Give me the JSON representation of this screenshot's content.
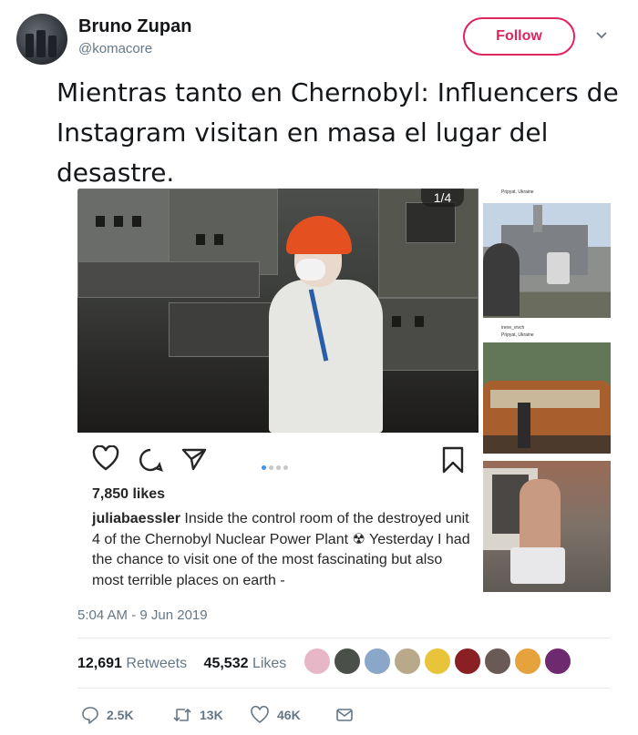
{
  "author": {
    "name": "Bruno Zupan",
    "handle": "@komacore",
    "follow_label": "Follow"
  },
  "tweet": {
    "text": "Mientras tanto en Chernobyl: Influencers de Instagram visitan en masa el lugar del desastre."
  },
  "instagram_post": {
    "page_indicator": "1/4",
    "carousel_position": 1,
    "carousel_total": 4,
    "likes": "7,850 likes",
    "username": "juliabaessler",
    "caption": "Inside the control room of the destroyed unit 4 of the Chernobyl Nuclear Power Plant ☢ Yesterday I had the chance to visit one of the most fascinating but also most terrible places on earth -"
  },
  "thumbnails": [
    {
      "location": "Pripyat, Ukraine"
    },
    {
      "user": "irene_vivch",
      "location": "Pripyat, Ukraine"
    },
    {}
  ],
  "meta": {
    "timestamp": "5:04 AM - 9 Jun 2019",
    "retweets_count": "12,691",
    "retweets_label": "Retweets",
    "likes_count": "45,532",
    "likes_label": "Likes"
  },
  "action_bar": {
    "replies": "2.5K",
    "retweets": "13K",
    "likes": "46K"
  },
  "colors": {
    "follow_accent": "#e0245e",
    "secondary_text": "#657786",
    "carousel_active": "#3897f0"
  },
  "icons": [
    "chevron-down-icon",
    "heart-icon",
    "comment-icon",
    "share-icon",
    "bookmark-icon",
    "reply-icon",
    "retweet-icon",
    "like-icon",
    "direct-message-icon"
  ]
}
